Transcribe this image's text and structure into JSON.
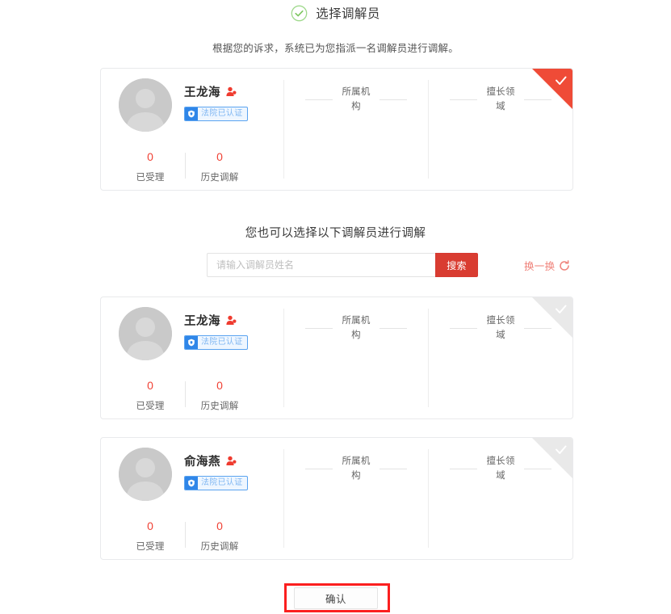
{
  "header": {
    "title": "选择调解员",
    "subtitle": "根据您的诉求，系统已为您指派一名调解员进行调解。",
    "check_icon": "check-circle-icon",
    "check_color": "#8dd07a"
  },
  "assigned_card": {
    "name": "王龙海",
    "gender_icon": "user-male-icon",
    "badge": {
      "icon": "shield-verified-icon",
      "text": "法院已认证"
    },
    "stats": [
      {
        "value": "0",
        "label": "已受理"
      },
      {
        "value": "0",
        "label": "历史调解"
      }
    ],
    "sections": [
      {
        "label": "所属机构",
        "value": ""
      },
      {
        "label": "擅长领域",
        "value": ""
      }
    ],
    "selected": true,
    "corner_icon": "check-icon"
  },
  "alt_section": {
    "heading": "您也可以选择以下调解员进行调解",
    "search": {
      "placeholder": "请输入调解员姓名",
      "value": "",
      "button_label": "搜索"
    },
    "refresh": {
      "label": "换一换",
      "icon": "refresh-icon"
    },
    "cards": [
      {
        "name": "王龙海",
        "gender_icon": "user-male-icon",
        "badge": {
          "icon": "shield-verified-icon",
          "text": "法院已认证"
        },
        "stats": [
          {
            "value": "0",
            "label": "已受理"
          },
          {
            "value": "0",
            "label": "历史调解"
          }
        ],
        "sections": [
          {
            "label": "所属机构",
            "value": ""
          },
          {
            "label": "擅长领域",
            "value": ""
          }
        ],
        "selected": false,
        "corner_icon": "check-icon"
      },
      {
        "name": "俞海燕",
        "gender_icon": "user-male-icon",
        "badge": {
          "icon": "shield-verified-icon",
          "text": "法院已认证"
        },
        "stats": [
          {
            "value": "0",
            "label": "已受理"
          },
          {
            "value": "0",
            "label": "历史调解"
          }
        ],
        "sections": [
          {
            "label": "所属机构",
            "value": ""
          },
          {
            "label": "擅长领域",
            "value": ""
          }
        ],
        "selected": false,
        "corner_icon": "check-icon"
      }
    ]
  },
  "footer": {
    "confirm_label": "确认",
    "highlight_color": "#fb1f1f"
  },
  "colors": {
    "accent_red": "#d93c31",
    "selected_corner": "#ef4b37",
    "unselected_corner": "#e9e9e9",
    "stat_value": "#f04134",
    "badge_blue": "#2f86e8",
    "check_green": "#8dd07a"
  }
}
